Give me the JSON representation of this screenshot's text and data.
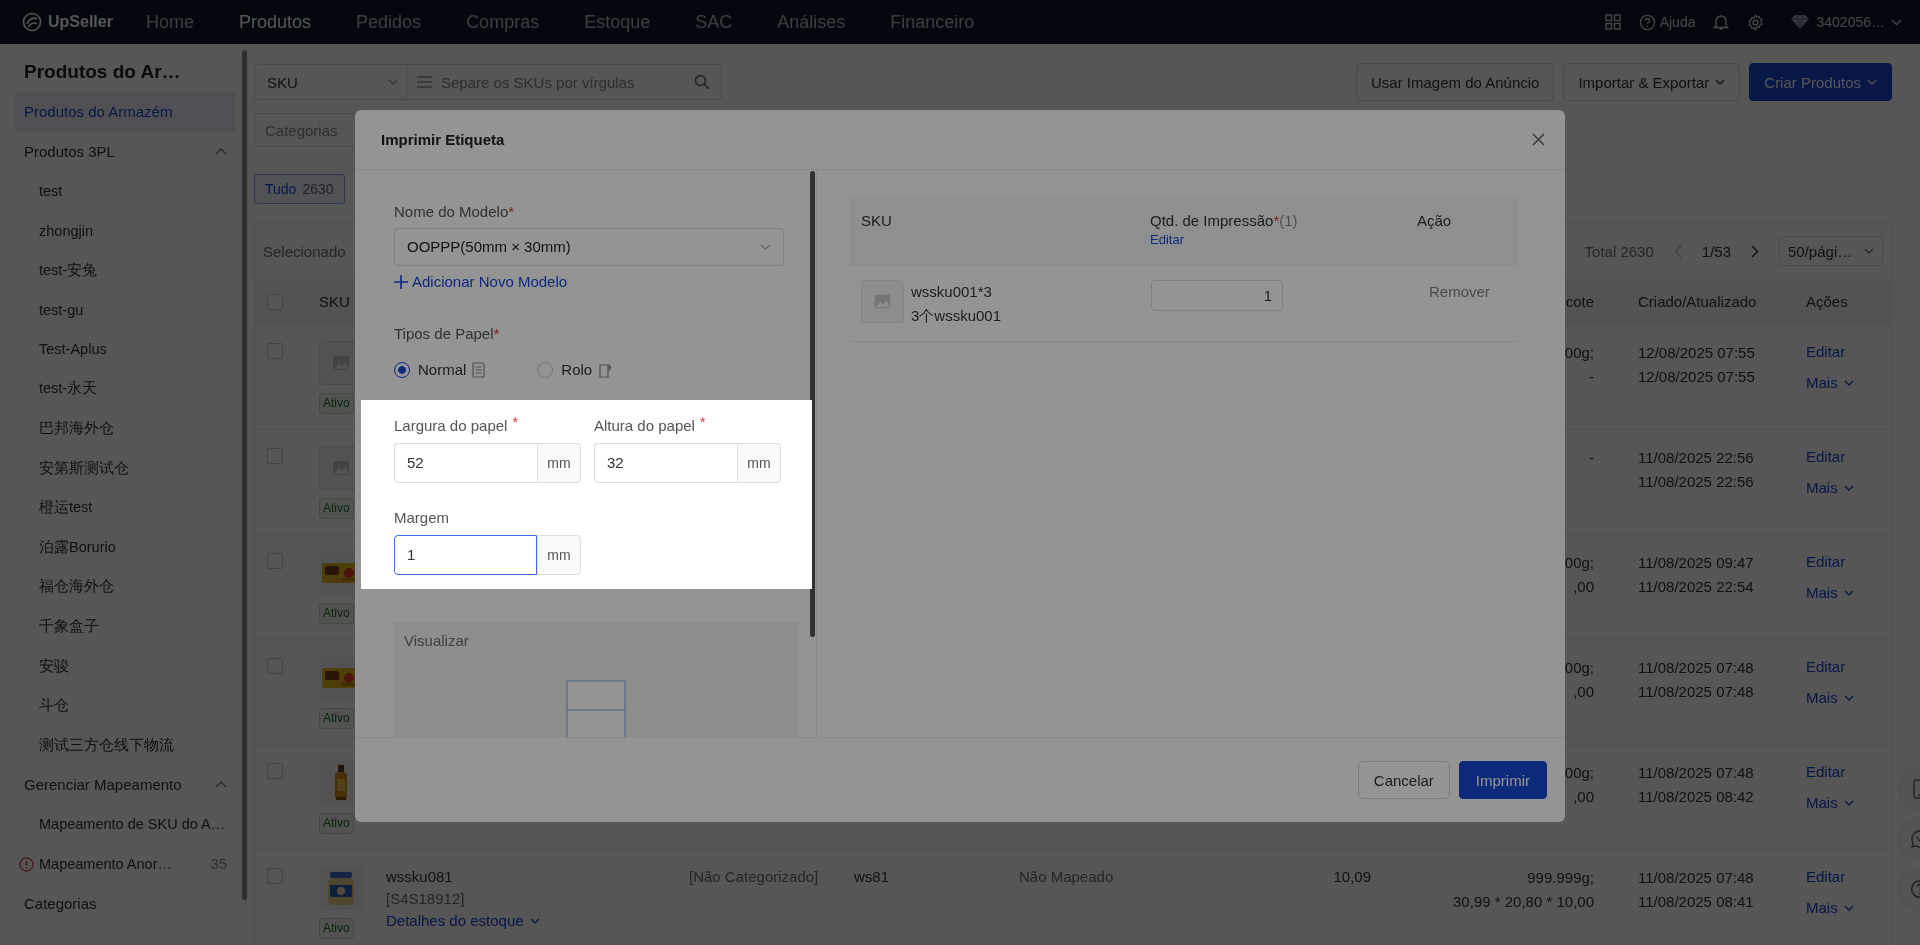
{
  "top_nav": {
    "logo": "UpSeller",
    "items": [
      {
        "label": "Home",
        "selected": false
      },
      {
        "label": "Produtos",
        "selected": true
      },
      {
        "label": "Pedidos",
        "selected": false
      },
      {
        "label": "Compras",
        "selected": false
      },
      {
        "label": "Estoque",
        "selected": false
      },
      {
        "label": "SAC",
        "selected": false
      },
      {
        "label": "Análises",
        "selected": false
      },
      {
        "label": "Financeiro",
        "selected": false
      }
    ],
    "help": "Ajuda",
    "account": "3402056…"
  },
  "sidebar": {
    "title": "Produtos do Ar…",
    "items": [
      {
        "kind": "link",
        "label": "Produtos do Armazém",
        "selected": true
      },
      {
        "kind": "group",
        "label": "Produtos 3PL",
        "expanded": true,
        "children": [
          {
            "label": "test",
            "selected": false,
            "alert": false
          },
          {
            "label": "zhongjin",
            "selected": false,
            "alert": false
          },
          {
            "label": "test-安兔",
            "selected": false,
            "alert": false
          },
          {
            "label": "test-gu",
            "selected": false,
            "alert": false
          },
          {
            "label": "Test-Aplus",
            "selected": false,
            "alert": false
          },
          {
            "label": "test-永天",
            "selected": false,
            "alert": false
          },
          {
            "label": "巴邦海外仓",
            "selected": false,
            "alert": false
          },
          {
            "label": "安第斯测试仓",
            "selected": false,
            "alert": false
          },
          {
            "label": "橙运test",
            "selected": false,
            "alert": false
          },
          {
            "label": "泊露Borurio",
            "selected": false,
            "alert": false
          },
          {
            "label": "福仓海外仓",
            "selected": false,
            "alert": false
          },
          {
            "label": "千象盒子",
            "selected": false,
            "alert": false
          },
          {
            "label": "安骏",
            "selected": false,
            "alert": false
          },
          {
            "label": "斗仓",
            "selected": false,
            "alert": false
          },
          {
            "label": "测试三方仓线下物流",
            "selected": false,
            "alert": false
          }
        ]
      },
      {
        "kind": "group",
        "label": "Gerenciar Mapeamento",
        "expanded": true,
        "children": [
          {
            "label": "Mapeamento de SKU do A…",
            "selected": false,
            "alert": false
          },
          {
            "label": "Mapeamento Anor…",
            "selected": false,
            "alert": true,
            "count": "35"
          }
        ]
      },
      {
        "kind": "link",
        "label": "Categorias",
        "selected": false
      }
    ]
  },
  "toolbar": {
    "search_type": "SKU",
    "search": {
      "placeholder": "Separe os SKUs por vírgulas"
    },
    "category": {
      "placeholder": "Categorias"
    },
    "buttons": [
      {
        "label": "Usar Imagem do Anúncio",
        "kind": "default",
        "dropdown": false
      },
      {
        "label": "Importar & Exportar",
        "kind": "default",
        "dropdown": true
      },
      {
        "label": "Criar Produtos",
        "kind": "primary",
        "dropdown": true
      }
    ]
  },
  "filter_tabs": [
    {
      "label": "Tudo",
      "count": "2630",
      "selected": true
    }
  ],
  "product_table": {
    "selection_label": "Selecionado",
    "total": "Total 2630",
    "page": "1/53",
    "page_size": "50/pági…",
    "header_checked": false,
    "columns": {
      "sku": "SKU",
      "column_7": "cote",
      "created_updated": "Criado/Atualizado",
      "actions": "Ações"
    },
    "rows": [
      {
        "checked": false,
        "thumbnail": {
          "kind": "placeholder"
        },
        "status": "Ativo",
        "column_7": [
          "00g;",
          "-"
        ],
        "created": "12/08/2025 07:55",
        "updated": "12/08/2025 07:55",
        "edit": "Editar",
        "more": "Mais"
      },
      {
        "checked": false,
        "thumbnail": {
          "kind": "placeholder"
        },
        "status": "Ativo",
        "column_7": [
          "-"
        ],
        "created": "11/08/2025 22:56",
        "updated": "11/08/2025 22:56",
        "edit": "Editar",
        "more": "Mais"
      },
      {
        "checked": false,
        "thumbnail": {
          "kind": "picture"
        },
        "status": "Ativo",
        "column_7": [
          "00g;",
          ",00"
        ],
        "created": "11/08/2025 09:47",
        "updated": "11/08/2025 22:54",
        "edit": "Editar",
        "more": "Mais"
      },
      {
        "checked": false,
        "thumbnail": {
          "kind": "picture"
        },
        "status": "Ativo",
        "column_7": [
          "00g;",
          ",00"
        ],
        "created": "11/08/2025 07:48",
        "updated": "11/08/2025 07:48",
        "edit": "Editar",
        "more": "Mais"
      },
      {
        "checked": false,
        "thumbnail": {
          "kind": "picture"
        },
        "status": "Ativo",
        "column_7": [
          "00g;",
          ",00"
        ],
        "created": "11/08/2025 07:48",
        "updated": "11/08/2025 08:42",
        "edit": "Editar",
        "more": "Mais"
      },
      {
        "checked": false,
        "thumbnail": {
          "kind": "picture"
        },
        "status": "Ativo",
        "name": "wssku081",
        "code": "[S4S18912]",
        "stock_link": "Detalhes do estoque",
        "category": "[Não Categorizado]",
        "sku_ref": "ws81",
        "mapping": "Não Mapeado",
        "price": "10,09",
        "column_7": [
          "999.999g;",
          "30,99 * 20,80 * 10,00"
        ],
        "created": "11/08/2025 07:48",
        "updated": "11/08/2025 08:41",
        "edit": "Editar",
        "more": "Mais"
      }
    ]
  },
  "print_dialog": {
    "title": "Imprimir Etiqueta",
    "template": {
      "label": "Nome do Modelo",
      "required_mark": "*",
      "value": "OOPPP(50mm × 30mm)"
    },
    "add_template": "Adicionar Novo Modelo",
    "paper_type": {
      "label": "Tipos de Papel",
      "required_mark": "*",
      "options": [
        {
          "label": "Normal",
          "selected": true,
          "kind": "sheet"
        },
        {
          "label": "Rolo",
          "selected": false,
          "kind": "roll"
        }
      ]
    },
    "paper_size": {
      "highlighted": true,
      "fields": [
        {
          "label": "Largura do papel",
          "required_mark": "*",
          "value": "52",
          "unit": "mm",
          "focused": false
        },
        {
          "label": "Altura do papel",
          "required_mark": "*",
          "value": "32",
          "unit": "mm",
          "focused": false
        },
        {
          "label": "Margem",
          "value": "1",
          "unit": "mm",
          "focused": true
        }
      ]
    },
    "preview": {
      "label": "Visualizar"
    },
    "sku_table": {
      "columns": [
        {
          "label": "SKU"
        },
        {
          "label": "Qtd. de Impressão",
          "required_mark": "*",
          "note": "(1)",
          "link": "Editar"
        },
        {
          "label": "Ação"
        }
      ],
      "rows": [
        {
          "sku": "wssku001*3",
          "name": "3个wssku001",
          "quantity": "1",
          "action": "Remover"
        }
      ]
    },
    "buttons": [
      {
        "label": "Cancelar",
        "kind": "default"
      },
      {
        "label": "Imprimir",
        "kind": "primary"
      }
    ]
  }
}
